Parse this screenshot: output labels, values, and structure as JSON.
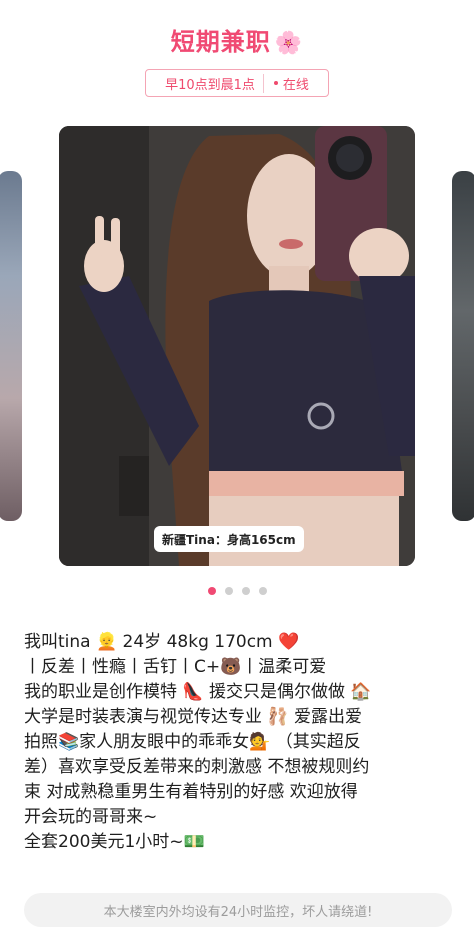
{
  "header": {
    "title": "短期兼职",
    "title_emoji": "🌸",
    "hours_label": "早10点到晨1点",
    "status_label": "在线"
  },
  "photo": {
    "caption": "新疆Tina：身高165cm"
  },
  "carousel": {
    "total": 4,
    "active_index": 0
  },
  "description": {
    "lines": [
      "我叫tina 👱 24岁 48kg 170cm ❤️",
      "丨反差丨性瘾丨舌钉丨C+🐻丨温柔可爱",
      "我的职业是创作模特 👠 援交只是偶尔做做 🏠",
      "大学是时装表演与视觉传达专业 🩰 爱露出爱",
      "拍照📚家人朋友眼中的乖乖女💁 （其实超反",
      "差）喜欢享受反差带来的刺激感 不想被规则约",
      "束 对成熟稳重男生有着特别的好感 欢迎放得",
      "开会玩的哥哥来~",
      "全套200美元1小时~💵"
    ]
  },
  "notice": {
    "text": "本大楼室内外均设有24小时监控，坏人请绕道!"
  },
  "colors": {
    "accent": "#f04a73",
    "border": "#f4a4b4",
    "notice_bg": "#f2f2f2"
  }
}
